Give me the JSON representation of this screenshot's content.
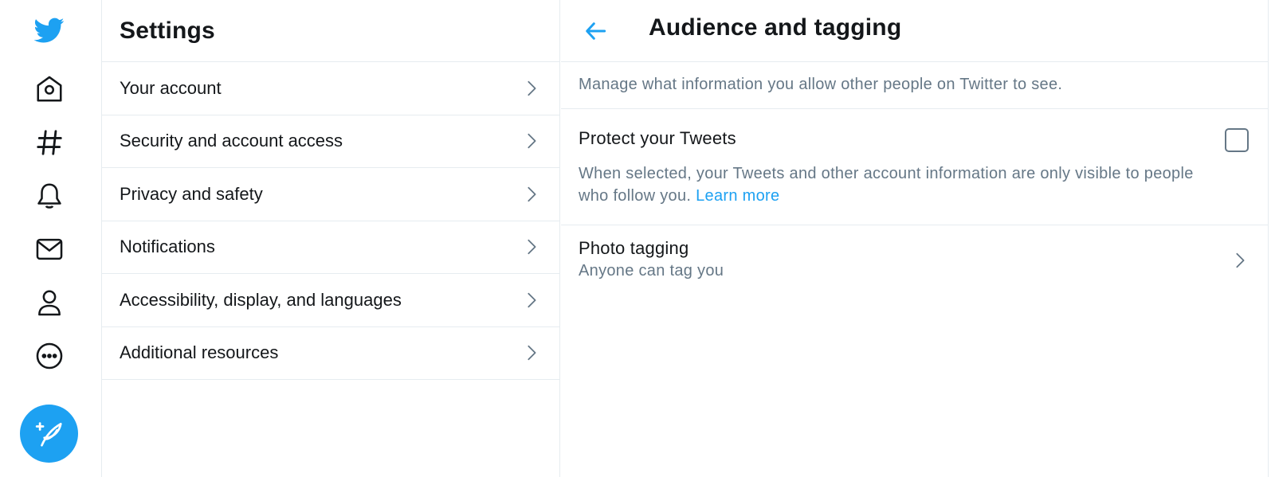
{
  "colors": {
    "brand": "#1da1f2",
    "text_primary": "#14171a",
    "text_secondary": "#657786",
    "border": "#e6ecf0"
  },
  "nav": {
    "items": [
      {
        "name": "home",
        "icon": "home-icon"
      },
      {
        "name": "explore",
        "icon": "hashtag-icon"
      },
      {
        "name": "notifications",
        "icon": "bell-icon"
      },
      {
        "name": "messages",
        "icon": "mail-icon"
      },
      {
        "name": "profile",
        "icon": "user-icon"
      },
      {
        "name": "more",
        "icon": "more-icon"
      }
    ],
    "logo_icon": "twitter-bird-icon",
    "compose_icon": "compose-feather-icon"
  },
  "settings": {
    "title": "Settings",
    "items": [
      {
        "label": "Your account"
      },
      {
        "label": "Security and account access"
      },
      {
        "label": "Privacy and safety"
      },
      {
        "label": "Notifications"
      },
      {
        "label": "Accessibility, display, and languages"
      },
      {
        "label": "Additional resources"
      }
    ]
  },
  "detail": {
    "title": "Audience and tagging",
    "back_icon": "arrow-left-icon",
    "intro": "Manage what information you allow other people on Twitter to see.",
    "protect": {
      "title": "Protect your Tweets",
      "description": "When selected, your Tweets and other account information are only visible to people who follow you.",
      "learn_more": "Learn more",
      "checked": false
    },
    "photo_tagging": {
      "title": "Photo tagging",
      "subtitle": "Anyone can tag you"
    }
  }
}
